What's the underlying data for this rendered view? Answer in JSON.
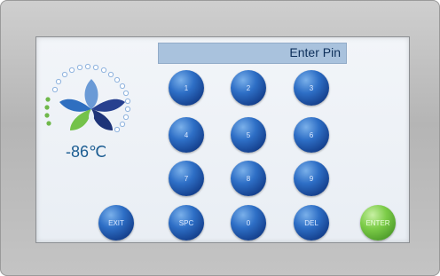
{
  "pin_prompt": "Enter Pin",
  "temperature": "-86℃",
  "keys": {
    "k1": "1",
    "k2": "2",
    "k3": "3",
    "k4": "4",
    "k5": "5",
    "k6": "6",
    "k7": "7",
    "k8": "8",
    "k9": "9",
    "exit": "EXIT",
    "spc": "SPC",
    "k0": "0",
    "del": "DEL",
    "enter": "ENTER"
  },
  "colors": {
    "key_blue": "#2e6fc6",
    "enter_green": "#7ccc48",
    "pin_field": "#a9c2dd",
    "temperature_text": "#1c5d92"
  },
  "icons": [
    "flower-logo-icon"
  ]
}
